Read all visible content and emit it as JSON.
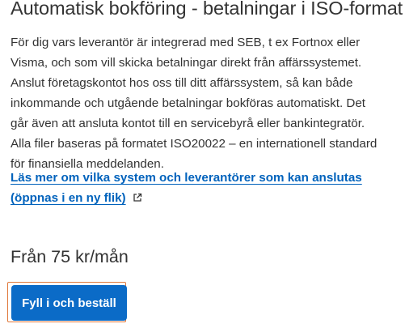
{
  "product": {
    "title": "Automatisk bokföring - betalningar i ISO-format",
    "description_lines": [
      "För dig vars leverantör är integrerad med SEB, t ex Fortnox eller",
      "Visma, och som vill skicka betalningar direkt från affärssystemet.",
      "Anslut företagskontot hos oss till ditt affärssystem, så kan både",
      "inkommande och utgående betalningar bokföras automatiskt. Det",
      "går även att ansluta kontot till en servicebyrå eller bankintegratör.",
      "Alla filer baseras på formatet ISO20022 – en internationell standard",
      "för finansiella meddelanden."
    ],
    "read_more_lines": [
      "Läs mer om vilka system och leverantörer som kan anslutas",
      "(öppnas i en ny flik)"
    ],
    "read_more_icon": "external-link-icon",
    "price": "Från 75 kr/mån",
    "order_button_label": "Fyll i och beställ"
  },
  "colors": {
    "text": "#333333",
    "link": "#0062bc",
    "button_bg": "#0b6bc7",
    "focus_ring": "#e0783a"
  }
}
